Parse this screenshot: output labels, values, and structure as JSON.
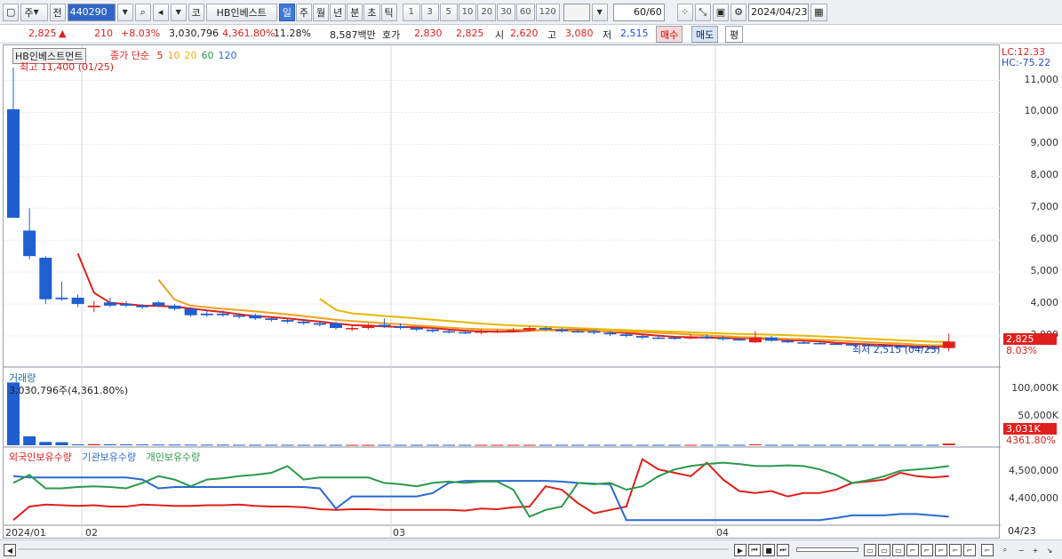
{
  "toolbar": {
    "period_type": "주",
    "prev_label": "전",
    "stock_code": "440290",
    "market_label": "코",
    "stock_name": "HB인베스트",
    "timeframes": [
      "일",
      "주",
      "월",
      "년",
      "분",
      "초",
      "틱"
    ],
    "selected_timeframe": "일",
    "intervals": [
      "1",
      "3",
      "5",
      "10",
      "20",
      "30",
      "60",
      "120"
    ],
    "count": "60",
    "count_total": "/60",
    "date": "2024/04/23"
  },
  "quote": {
    "price": "2,825",
    "change_arrow": "▲",
    "change": "210",
    "change_pct": "+8.03%",
    "volume": "3,030,796",
    "volume_ratio": "4,361.80%",
    "turnover": "11.28%",
    "trade_value": "8,587백만",
    "ask_label": "호가",
    "ask": "2,830",
    "bid": "2,825",
    "open_label": "시",
    "open": "2,620",
    "high_label": "고",
    "high": "3,080",
    "low_label": "저",
    "low": "2,515",
    "buy_label": "매수",
    "sell_label": "매도",
    "flat_label": "평"
  },
  "price_panel": {
    "name_tag": "HB인베스트먼트",
    "ma_title": "종가 단순",
    "ma_periods": [
      "5",
      "10",
      "20",
      "60",
      "120"
    ],
    "ma_colors": [
      "#e0201c",
      "#f0a020",
      "#e8b800",
      "#2a9a4a",
      "#2a6ad0"
    ],
    "max_label": "최고 11,400 (01/25)",
    "min_label": "최저 2,515 (04/23)",
    "lc": "LC:12.33",
    "hc": "HC:-75.22",
    "last_tag": "2,825",
    "pct_tag": "8.03%",
    "yticks": [
      "11,000",
      "10,000",
      "9,000",
      "8,000",
      "7,000",
      "6,000",
      "5,000",
      "4,000",
      "3,000"
    ]
  },
  "volume_panel": {
    "title": "거래량",
    "value_label": "3,030,796주(4,361.80%)",
    "yticks": [
      "100,000K",
      "50,000K"
    ],
    "last_tag": "3,031K",
    "pct_tag": "4361.80%"
  },
  "holding_panel": {
    "legend": [
      "외국인보유수량",
      "기관보유수량",
      "개인보유수량"
    ],
    "colors": [
      "#e0201c",
      "#2a6ad0",
      "#2a9a4a"
    ],
    "yticks": [
      "4,500,000",
      "4,400,000"
    ]
  },
  "dates": [
    "2024/01",
    "02",
    "03",
    "04"
  ],
  "last_date": "04/23",
  "chart_data": {
    "type": "candlestick",
    "ylim": [
      2500,
      11600
    ],
    "candles": [
      {
        "o": 6700,
        "c": 10100,
        "h": 11400,
        "l": 6700,
        "up": false
      },
      {
        "o": 6300,
        "c": 5500,
        "h": 7000,
        "l": 5400,
        "up": false
      },
      {
        "o": 5450,
        "c": 4150,
        "h": 5500,
        "l": 4000,
        "up": false
      },
      {
        "o": 4200,
        "c": 4150,
        "h": 4700,
        "l": 4100,
        "up": false
      },
      {
        "o": 4200,
        "c": 4000,
        "h": 4300,
        "l": 3900,
        "up": false
      },
      {
        "o": 3900,
        "c": 3950,
        "h": 4100,
        "l": 3750,
        "up": true
      },
      {
        "o": 4050,
        "c": 3950,
        "h": 4200,
        "l": 3900,
        "up": false
      },
      {
        "o": 4000,
        "c": 3950,
        "h": 4100,
        "l": 3900,
        "up": false
      },
      {
        "o": 3950,
        "c": 3900,
        "h": 4000,
        "l": 3850,
        "up": false
      },
      {
        "o": 4050,
        "c": 3950,
        "h": 4100,
        "l": 3900,
        "up": false
      },
      {
        "o": 3950,
        "c": 3850,
        "h": 4000,
        "l": 3800,
        "up": false
      },
      {
        "o": 3850,
        "c": 3650,
        "h": 3900,
        "l": 3600,
        "up": false
      },
      {
        "o": 3700,
        "c": 3650,
        "h": 3800,
        "l": 3600,
        "up": false
      },
      {
        "o": 3700,
        "c": 3650,
        "h": 3800,
        "l": 3600,
        "up": false
      },
      {
        "o": 3650,
        "c": 3600,
        "h": 3700,
        "l": 3550,
        "up": false
      },
      {
        "o": 3650,
        "c": 3550,
        "h": 3700,
        "l": 3500,
        "up": false
      },
      {
        "o": 3550,
        "c": 3500,
        "h": 3600,
        "l": 3450,
        "up": false
      },
      {
        "o": 3500,
        "c": 3450,
        "h": 3550,
        "l": 3400,
        "up": false
      },
      {
        "o": 3450,
        "c": 3400,
        "h": 3500,
        "l": 3350,
        "up": false
      },
      {
        "o": 3400,
        "c": 3350,
        "h": 3450,
        "l": 3300,
        "up": false
      },
      {
        "o": 3400,
        "c": 3250,
        "h": 3450,
        "l": 3200,
        "up": false
      },
      {
        "o": 3250,
        "c": 3250,
        "h": 3350,
        "l": 3150,
        "up": true
      },
      {
        "o": 3250,
        "c": 3350,
        "h": 3400,
        "l": 3200,
        "up": true
      },
      {
        "o": 3350,
        "c": 3300,
        "h": 3550,
        "l": 3250,
        "up": false
      },
      {
        "o": 3300,
        "c": 3250,
        "h": 3400,
        "l": 3200,
        "up": false
      },
      {
        "o": 3250,
        "c": 3200,
        "h": 3300,
        "l": 3150,
        "up": false
      },
      {
        "o": 3200,
        "c": 3150,
        "h": 3250,
        "l": 3100,
        "up": false
      },
      {
        "o": 3150,
        "c": 3120,
        "h": 3200,
        "l": 3080,
        "up": false
      },
      {
        "o": 3120,
        "c": 3100,
        "h": 3180,
        "l": 3060,
        "up": false
      },
      {
        "o": 3100,
        "c": 3150,
        "h": 3200,
        "l": 3050,
        "up": true
      },
      {
        "o": 3150,
        "c": 3150,
        "h": 3200,
        "l": 3100,
        "up": true
      },
      {
        "o": 3150,
        "c": 3180,
        "h": 3250,
        "l": 3100,
        "up": true
      },
      {
        "o": 3180,
        "c": 3250,
        "h": 3300,
        "l": 3150,
        "up": true
      },
      {
        "o": 3250,
        "c": 3200,
        "h": 3300,
        "l": 3150,
        "up": false
      },
      {
        "o": 3200,
        "c": 3150,
        "h": 3250,
        "l": 3100,
        "up": false
      },
      {
        "o": 3150,
        "c": 3150,
        "h": 3200,
        "l": 3100,
        "up": false
      },
      {
        "o": 3150,
        "c": 3100,
        "h": 3200,
        "l": 3050,
        "up": false
      },
      {
        "o": 3100,
        "c": 3050,
        "h": 3150,
        "l": 3000,
        "up": false
      },
      {
        "o": 3050,
        "c": 3000,
        "h": 3100,
        "l": 2950,
        "up": false
      },
      {
        "o": 3000,
        "c": 2950,
        "h": 3050,
        "l": 2900,
        "up": false
      },
      {
        "o": 2950,
        "c": 2950,
        "h": 3000,
        "l": 2900,
        "up": false
      },
      {
        "o": 2950,
        "c": 2920,
        "h": 3000,
        "l": 2880,
        "up": false
      },
      {
        "o": 2920,
        "c": 2980,
        "h": 3050,
        "l": 2900,
        "up": true
      },
      {
        "o": 2980,
        "c": 2940,
        "h": 3050,
        "l": 2900,
        "up": false
      },
      {
        "o": 2940,
        "c": 2900,
        "h": 3000,
        "l": 2850,
        "up": false
      },
      {
        "o": 2900,
        "c": 2880,
        "h": 2950,
        "l": 2850,
        "up": false
      },
      {
        "o": 2800,
        "c": 2950,
        "h": 3150,
        "l": 2780,
        "up": true
      },
      {
        "o": 2950,
        "c": 2850,
        "h": 3000,
        "l": 2820,
        "up": false
      },
      {
        "o": 2850,
        "c": 2800,
        "h": 2900,
        "l": 2780,
        "up": false
      },
      {
        "o": 2800,
        "c": 2780,
        "h": 2850,
        "l": 2750,
        "up": false
      },
      {
        "o": 2780,
        "c": 2760,
        "h": 2820,
        "l": 2740,
        "up": false
      },
      {
        "o": 2760,
        "c": 2740,
        "h": 2800,
        "l": 2720,
        "up": false
      },
      {
        "o": 2740,
        "c": 2720,
        "h": 2780,
        "l": 2700,
        "up": false
      },
      {
        "o": 2720,
        "c": 2700,
        "h": 2760,
        "l": 2680,
        "up": false
      },
      {
        "o": 2700,
        "c": 2680,
        "h": 2740,
        "l": 2660,
        "up": false
      },
      {
        "o": 2680,
        "c": 2650,
        "h": 2720,
        "l": 2620,
        "up": false
      },
      {
        "o": 2650,
        "c": 2630,
        "h": 2700,
        "l": 2600,
        "up": false
      },
      {
        "o": 2630,
        "c": 2615,
        "h": 2680,
        "l": 2580,
        "up": false
      },
      {
        "o": 2620,
        "c": 2825,
        "h": 3080,
        "l": 2515,
        "up": true
      }
    ],
    "volume_k": [
      113000,
      16000,
      6000,
      5500,
      1500,
      2000,
      1800,
      1500,
      1400,
      1300,
      1200,
      1100,
      1000,
      1000,
      900,
      900,
      900,
      900,
      800,
      800,
      800,
      800,
      800,
      800,
      800,
      800,
      800,
      800,
      800,
      800,
      800,
      800,
      800,
      800,
      800,
      800,
      800,
      800,
      800,
      800,
      800,
      800,
      800,
      800,
      800,
      800,
      1500,
      800,
      800,
      800,
      800,
      800,
      800,
      800,
      800,
      800,
      800,
      800,
      3031
    ]
  }
}
